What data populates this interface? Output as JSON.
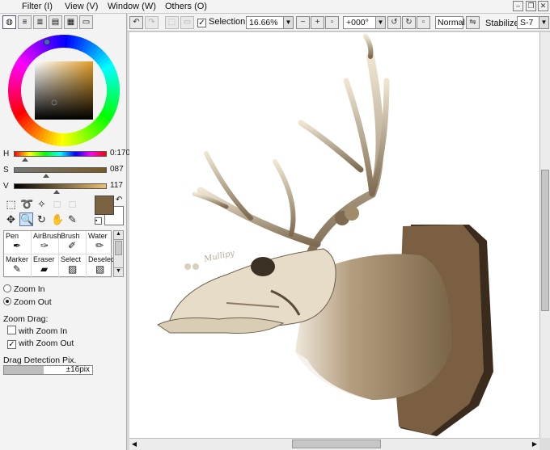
{
  "menu": [
    "Filter (I)",
    "View (V)",
    "Window (W)",
    "Others (O)"
  ],
  "color": {
    "h_label": "H",
    "h_value": "0:170",
    "s_label": "S",
    "s_value": "087",
    "v_label": "V",
    "v_value": "117",
    "main_color": "#7a6242",
    "sub_color": "#ffffff"
  },
  "brushes": [
    "Pen",
    "AirBrush",
    "Brush",
    "Water",
    "Marker",
    "Eraser",
    "Select",
    "Deselect"
  ],
  "zoom_options": {
    "zoom_in": "Zoom In",
    "zoom_out": "Zoom Out",
    "drag_heading": "Zoom Drag:",
    "with_zoom_in": "with Zoom In",
    "with_zoom_out": "with Zoom Out",
    "drag_detection": "Drag Detection Pix.",
    "drag_value": "±16pix",
    "drag_fill": 0.45
  },
  "toolbar": {
    "selection_label": "Selection",
    "zoom_value": "16.66%",
    "rotation_value": "+000°",
    "blend_mode": "Normal",
    "stabilizer_label": "Stabilizer",
    "stabilizer_value": "S-7"
  },
  "canvas_art": {
    "signature": "Mullipy"
  }
}
